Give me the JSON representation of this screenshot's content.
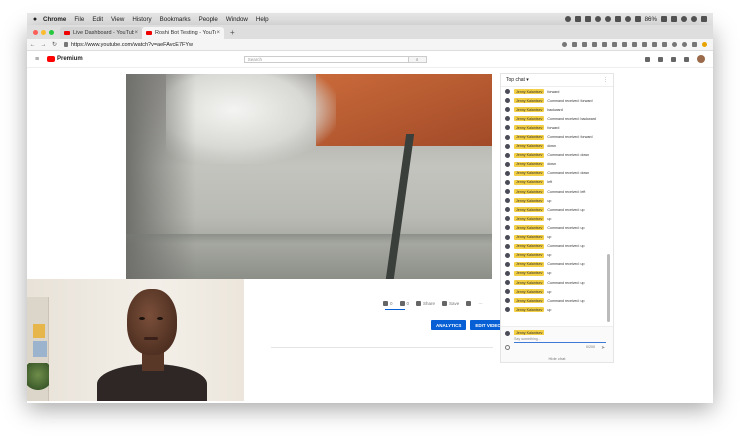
{
  "menubar": {
    "apple": "",
    "items": [
      "Chrome",
      "File",
      "Edit",
      "View",
      "History",
      "Bookmarks",
      "People",
      "Window",
      "Help"
    ],
    "battery": "86%"
  },
  "tabs": [
    {
      "title": "Live Dashboard - YouTube",
      "active": false
    },
    {
      "title": "Roshi Bot Testing - YouTube",
      "active": true
    }
  ],
  "address": {
    "url": "https://www.youtube.com/watch?v=aeFAvcE7FYw"
  },
  "youtube": {
    "logo": "Premium",
    "search_placeholder": "Search"
  },
  "video_actions": {
    "likes": "0",
    "dislikes": "0",
    "share": "Share",
    "save": "Save",
    "analytics": "ANALYTICS",
    "edit": "EDIT VIDEO"
  },
  "chat": {
    "header": "Top chat",
    "user": "Jenny Kalantsev",
    "messages": [
      "forward",
      "Command received: forward",
      "backward",
      "Command received: backward",
      "forward",
      "Command received: forward",
      "down",
      "Command received: down",
      "down",
      "Command received: down",
      "left",
      "Command received: left",
      "up",
      "Command received: up",
      "up",
      "Command received: up",
      "up",
      "Command received: up",
      "up",
      "Command received: up",
      "up",
      "Command received: up",
      "up",
      "Command received: up",
      "up"
    ],
    "input_user": "Jenny Kalantsev",
    "input_placeholder": "Say something...",
    "char_count": "0/200",
    "hide": "Hide chat"
  }
}
